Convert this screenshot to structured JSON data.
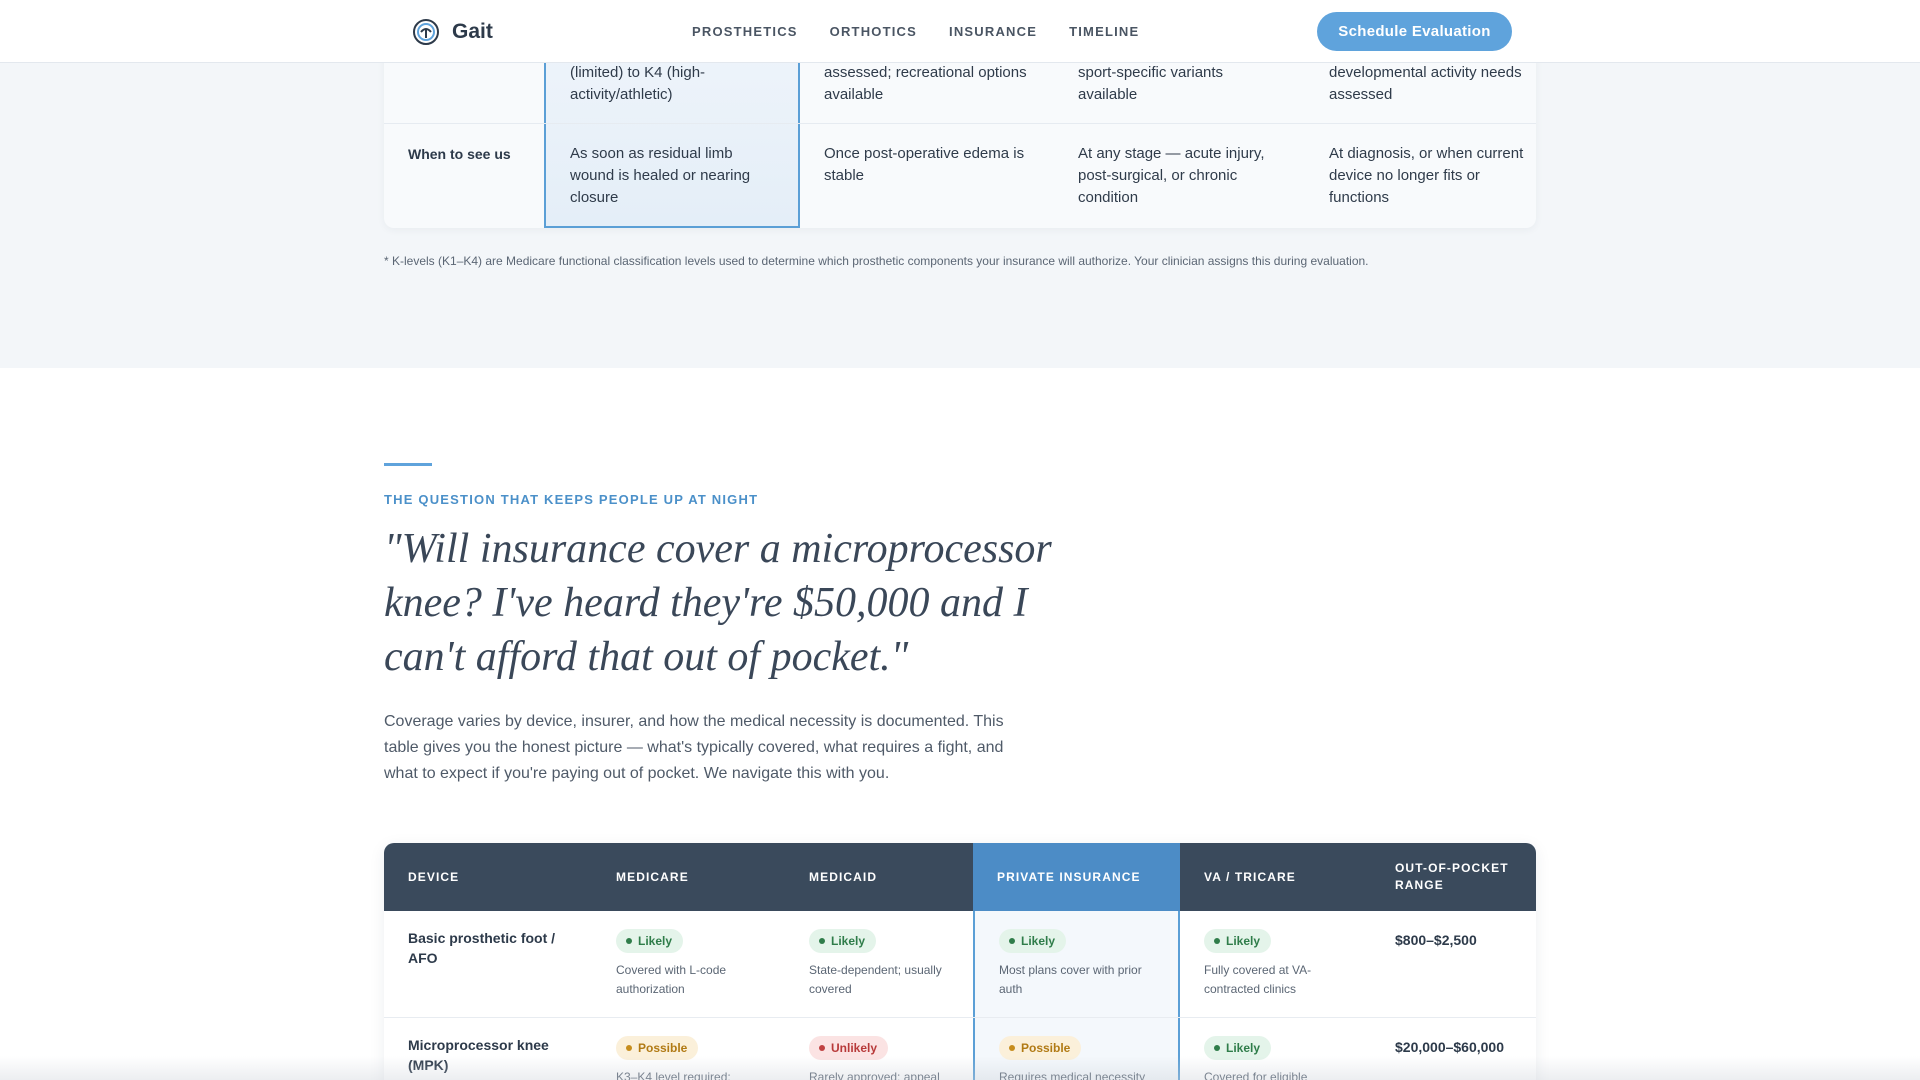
{
  "nav": {
    "brand": "Gait",
    "links": [
      "PROSTHETICS",
      "ORTHOTICS",
      "INSURANCE",
      "TIMELINE"
    ],
    "cta": "Schedule Evaluation"
  },
  "comparison": {
    "continued_row": {
      "cells": [
        "(limited) to K4 (high-activity/athletic)",
        "assessed; recreational options available",
        "sport-specific variants available",
        "developmental activity needs assessed"
      ]
    },
    "when_row": {
      "label": "When to see us",
      "cells": [
        "As soon as residual limb wound is healed or nearing closure",
        "Once post-operative edema is stable",
        "At any stage — acute injury, post-surgical, or chronic condition",
        "At diagnosis, or when current device no longer fits or functions"
      ]
    },
    "footnote": "* K-levels (K1–K4) are Medicare functional classification levels used to determine which prosthetic components your insurance will authorize. Your clinician assigns this during evaluation."
  },
  "insurance": {
    "eyebrow": "THE QUESTION THAT KEEPS PEOPLE UP AT NIGHT",
    "quote": "\"Will insurance cover a microprocessor knee? I've heard they're $50,000 and I can't afford that out of pocket.\"",
    "intro": "Coverage varies by device, insurer, and how the medical necessity is documented. This table gives you the honest picture — what's typically covered, what requires a fight, and what to expect if you're paying out of pocket. We navigate this with you.",
    "table": {
      "headers": [
        "DEVICE",
        "MEDICARE",
        "MEDICAID",
        "PRIVATE INSURANCE",
        "VA / TRICARE",
        "OUT-OF-POCKET RANGE"
      ],
      "rows": [
        {
          "device": "Basic prosthetic foot / AFO",
          "medicare": {
            "status": "Likely",
            "note": "Covered with L-code authorization"
          },
          "medicaid": {
            "status": "Likely",
            "note": "State-dependent; usually covered"
          },
          "private": {
            "status": "Likely",
            "note": "Most plans cover with prior auth"
          },
          "va": {
            "status": "Likely",
            "note": "Fully covered at VA-contracted clinics"
          },
          "oop": "$800–$2,500"
        },
        {
          "device": "Microprocessor knee (MPK)",
          "medicare": {
            "status": "Possible",
            "note": "K3–K4 level required;"
          },
          "medicaid": {
            "status": "Unlikely",
            "note": "Rarely approved; appeal"
          },
          "private": {
            "status": "Possible",
            "note": "Requires medical necessity"
          },
          "va": {
            "status": "Likely",
            "note": "Covered for eligible"
          },
          "oop": "$20,000–$60,000"
        }
      ]
    }
  },
  "colors": {
    "accent": "#5fa3dc",
    "header": "#3a4a5c",
    "highlight_header": "#4c8cc6",
    "likely": "#2f7d4a",
    "possible": "#b17a14",
    "unlikely": "#b83a3a"
  }
}
